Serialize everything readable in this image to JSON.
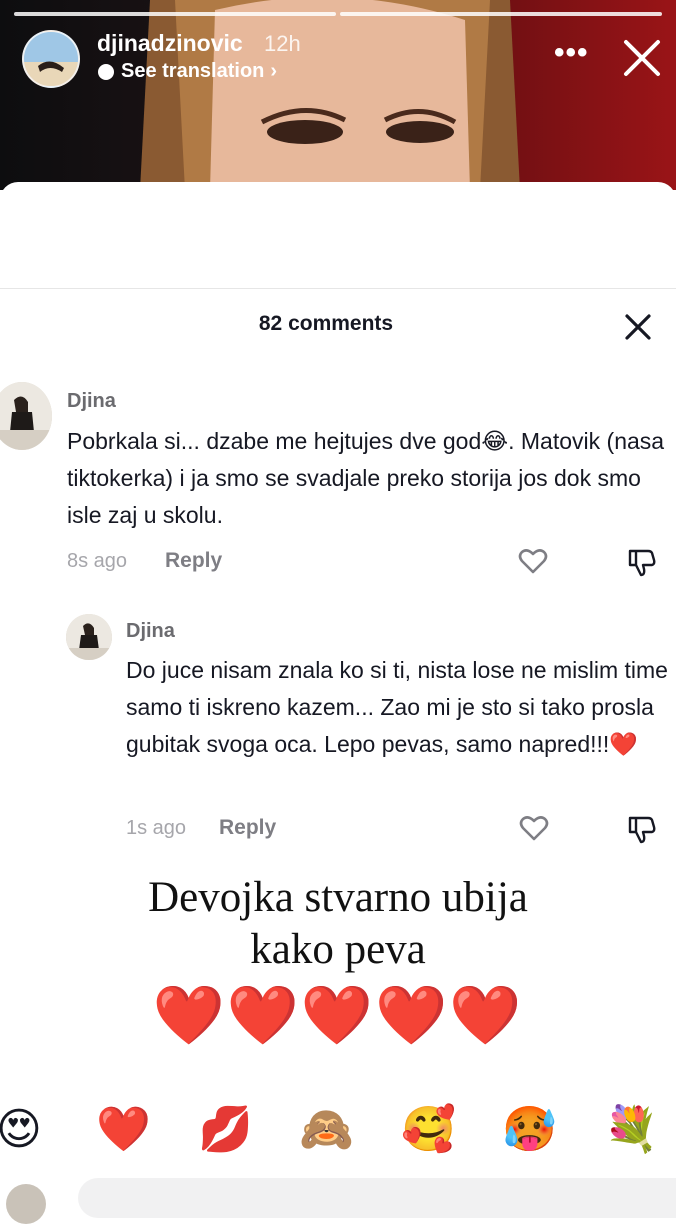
{
  "story": {
    "username": "djinadzinovic",
    "time": "12h",
    "see_translation": "See translation",
    "more_label": "•••"
  },
  "comments_header": {
    "count_label": "82 comments"
  },
  "comments": [
    {
      "author": "Djina",
      "text": "Pobrkala si... dzabe me hejtujes dve god😂. Matovik (nasa tiktokerka) i ja smo se svadjale preko storija jos dok smo isle zaj u skolu.",
      "time": "8s ago",
      "reply_label": "Reply"
    },
    {
      "author": "Djina",
      "text": "Do juce nisam znala ko si ti, nista lose ne mislim time samo ti iskreno kazem... Zao mi je sto si tako prosla gubitak svoga oca. Lepo pevas, samo napred!!!❤️",
      "time": "1s ago",
      "reply_label": "Reply"
    }
  ],
  "overlay": {
    "line1": "Devojka stvarno ubija",
    "line2": "kako peva",
    "hearts": "❤️❤️❤️❤️❤️"
  },
  "emoji_bar": [
    "😍",
    "❤️",
    "💋",
    "🙈",
    "🥰",
    "🥵",
    "💐"
  ],
  "colors": {
    "heart_red": "#e0131c",
    "meta_gray": "#a6a6ab"
  }
}
